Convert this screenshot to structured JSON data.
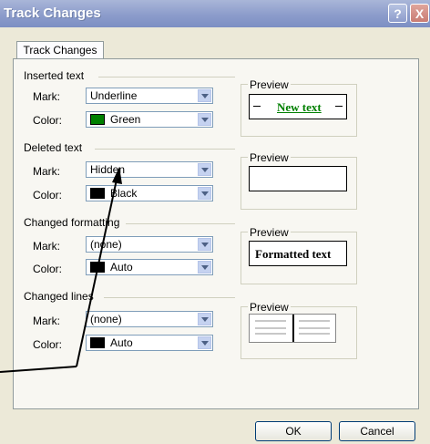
{
  "title": "Track Changes",
  "title_buttons": {
    "help": "?",
    "close": "X"
  },
  "tab_label": "Track Changes",
  "groups": {
    "inserted": {
      "title": "Inserted text",
      "mark_label": "Mark:",
      "mark_value": "Underline",
      "color_label": "Color:",
      "color_value": "Green",
      "color_swatch": "#008000",
      "preview_title": "Preview",
      "preview_text": "New text"
    },
    "deleted": {
      "title": "Deleted text",
      "mark_label": "Mark:",
      "mark_value": "Hidden",
      "color_label": "Color:",
      "color_value": "Black",
      "color_swatch": "#000000",
      "preview_title": "Preview",
      "preview_text": ""
    },
    "formatting": {
      "title": "Changed formatting",
      "mark_label": "Mark:",
      "mark_value": "(none)",
      "color_label": "Color:",
      "color_value": "Auto",
      "color_swatch": "#000000",
      "preview_title": "Preview",
      "preview_text": "Formatted text"
    },
    "lines": {
      "title": "Changed lines",
      "mark_label": "Mark:",
      "mark_value": "(none)",
      "color_label": "Color:",
      "color_value": "Auto",
      "color_swatch": "#000000",
      "preview_title": "Preview"
    }
  },
  "buttons": {
    "ok": "OK",
    "cancel": "Cancel"
  }
}
